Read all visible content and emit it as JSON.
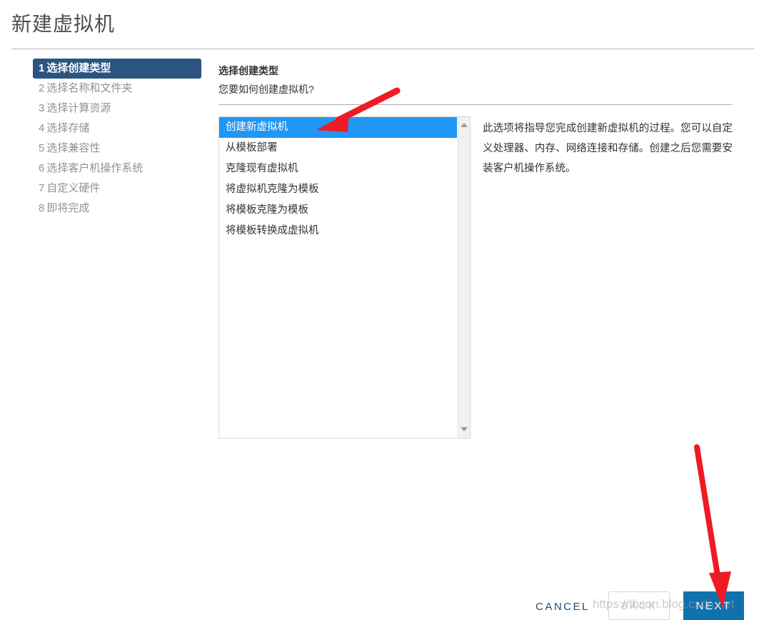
{
  "wizard": {
    "title": "新建虚拟机",
    "steps": [
      {
        "num": "1",
        "label": "选择创建类型",
        "active": true
      },
      {
        "num": "2",
        "label": "选择名称和文件夹",
        "active": false
      },
      {
        "num": "3",
        "label": "选择计算资源",
        "active": false
      },
      {
        "num": "4",
        "label": "选择存储",
        "active": false
      },
      {
        "num": "5",
        "label": "选择兼容性",
        "active": false
      },
      {
        "num": "6",
        "label": "选择客户机操作系统",
        "active": false
      },
      {
        "num": "7",
        "label": "自定义硬件",
        "active": false
      },
      {
        "num": "8",
        "label": "即将完成",
        "active": false
      }
    ]
  },
  "content": {
    "heading": "选择创建类型",
    "question": "您要如何创建虚拟机?",
    "options": [
      {
        "label": "创建新虚拟机",
        "selected": true
      },
      {
        "label": "从模板部署",
        "selected": false
      },
      {
        "label": "克隆现有虚拟机",
        "selected": false
      },
      {
        "label": "将虚拟机克隆为模板",
        "selected": false
      },
      {
        "label": "将模板克隆为模板",
        "selected": false
      },
      {
        "label": "将模板转换成虚拟机",
        "selected": false
      }
    ],
    "description": "此选项将指导您完成创建新虚拟机的过程。您可以自定义处理器、内存、网络连接和存储。创建之后您需要安装客户机操作系统。"
  },
  "footer": {
    "cancel_label": "CANCEL",
    "back_label": "BACK",
    "next_label": "NEXT"
  },
  "watermark": {
    "text": "https://thson.blog.csdn.net"
  },
  "colors": {
    "sidebar_active": "#2b5580",
    "option_selected": "#2196f3",
    "next_button": "#1072ad",
    "cancel_text": "#1c4e78",
    "annotation_arrow": "#ee1b24"
  }
}
